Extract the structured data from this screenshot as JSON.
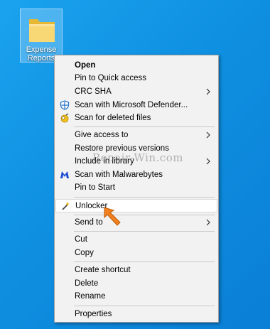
{
  "desktop": {
    "icon_label": "Expense\nReports"
  },
  "watermark": "Repair-Win.com",
  "menu": {
    "items": {
      "open": "Open",
      "pin_quick": "Pin to Quick access",
      "crc": "CRC SHA",
      "defender": "Scan with Microsoft Defender...",
      "deleted": "Scan for deleted files",
      "give_access": "Give access to",
      "restore": "Restore previous versions",
      "include": "Include in library",
      "malware": "Scan with Malwarebytes",
      "pin_start": "Pin to Start",
      "unlocker": "Unlocker",
      "send_to": "Send to",
      "cut": "Cut",
      "copy": "Copy",
      "create_shortcut": "Create shortcut",
      "delete": "Delete",
      "rename": "Rename",
      "properties": "Properties"
    }
  },
  "colors": {
    "desktop": "#0f8fe0",
    "menu_bg": "#f2f2f2",
    "highlight": "#ffffff",
    "pointer": "#f08020"
  }
}
